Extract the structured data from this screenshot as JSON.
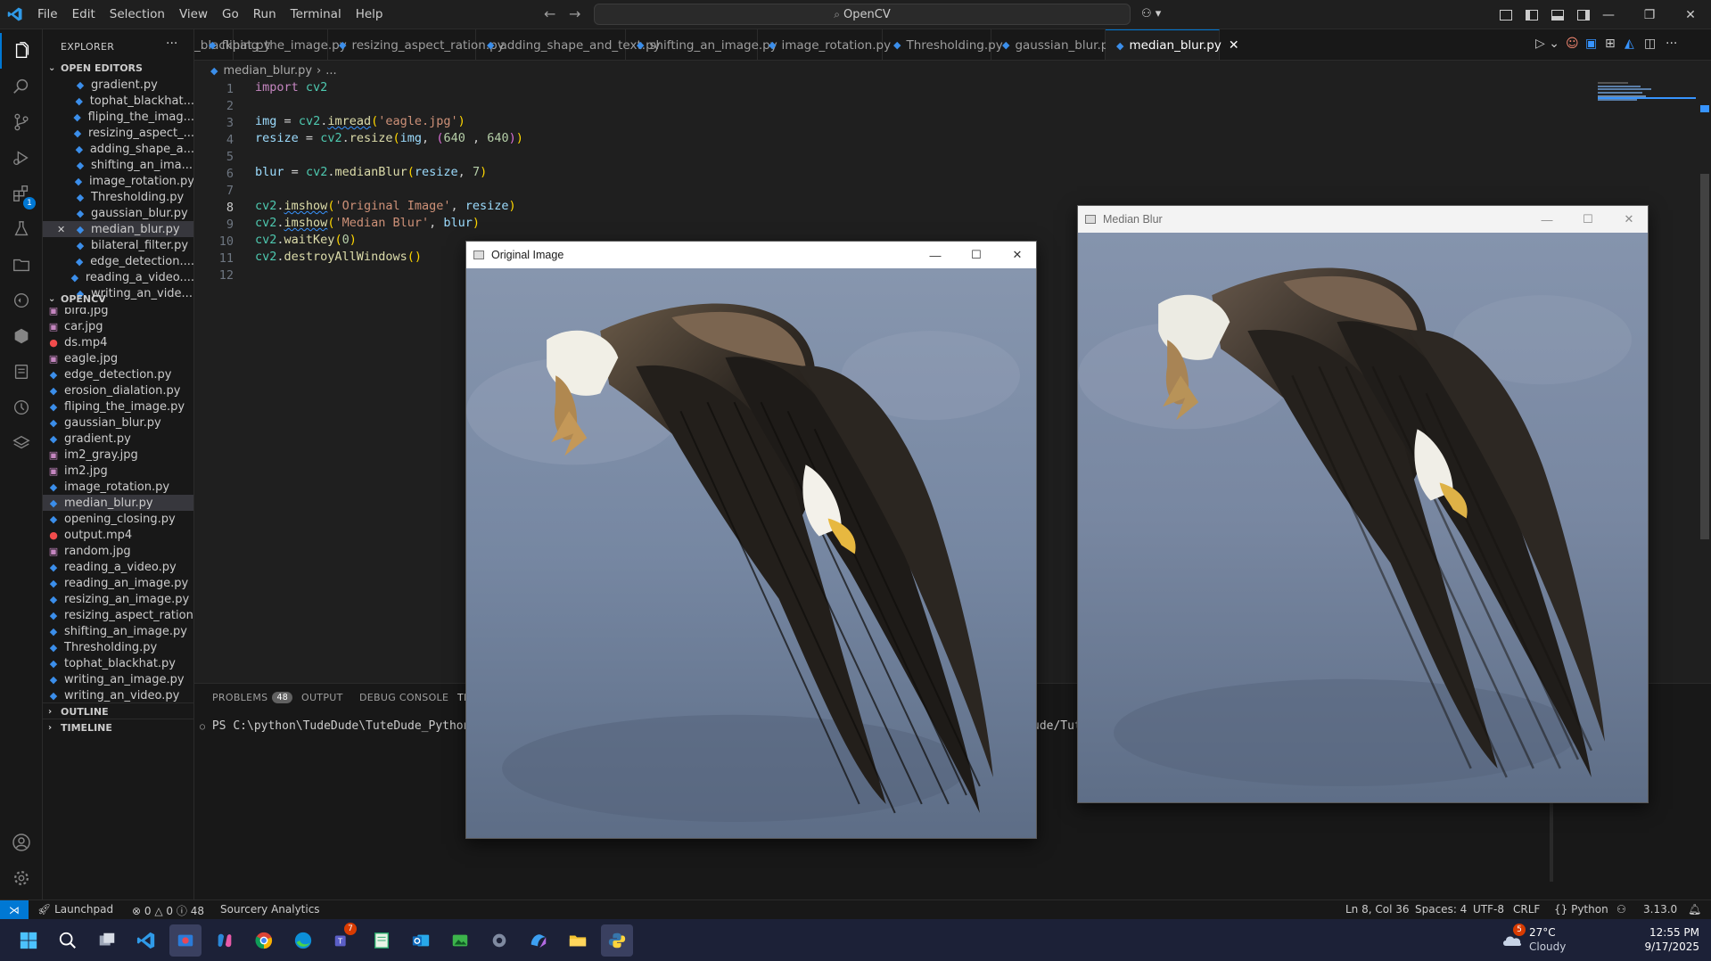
{
  "titlebar": {
    "menus": [
      "File",
      "Edit",
      "Selection",
      "View",
      "Go",
      "Run",
      "Terminal",
      "Help"
    ],
    "search": "OpenCV"
  },
  "sidebar": {
    "title": "EXPLORER",
    "open_editors_label": "OPEN EDITORS",
    "open_editors": [
      "gradient.py",
      "tophat_blackhat...",
      "fliping_the_imag...",
      "resizing_aspect_...",
      "adding_shape_a...",
      "shifting_an_ima...",
      "image_rotation.py",
      "Thresholding.py",
      "gaussian_blur.py",
      "median_blur.py",
      "bilateral_filter.py",
      "edge_detection....",
      "reading_a_video....",
      "writing_an_vide..."
    ],
    "folder_label": "OPENCV",
    "files": [
      {
        "name": "bird.jpg",
        "type": "img"
      },
      {
        "name": "car.jpg",
        "type": "img"
      },
      {
        "name": "ds.mp4",
        "type": "mp4"
      },
      {
        "name": "eagle.jpg",
        "type": "img"
      },
      {
        "name": "edge_detection.py",
        "type": "py"
      },
      {
        "name": "erosion_dialation.py",
        "type": "py"
      },
      {
        "name": "fliping_the_image.py",
        "type": "py"
      },
      {
        "name": "gaussian_blur.py",
        "type": "py"
      },
      {
        "name": "gradient.py",
        "type": "py"
      },
      {
        "name": "im2_gray.jpg",
        "type": "img"
      },
      {
        "name": "im2.jpg",
        "type": "img"
      },
      {
        "name": "image_rotation.py",
        "type": "py"
      },
      {
        "name": "median_blur.py",
        "type": "py"
      },
      {
        "name": "opening_closing.py",
        "type": "py"
      },
      {
        "name": "output.mp4",
        "type": "mp4"
      },
      {
        "name": "random.jpg",
        "type": "img"
      },
      {
        "name": "reading_a_video.py",
        "type": "py"
      },
      {
        "name": "reading_an_image.py",
        "type": "py"
      },
      {
        "name": "resizing_an_image.py",
        "type": "py"
      },
      {
        "name": "resizing_aspect_ration...",
        "type": "py"
      },
      {
        "name": "shifting_an_image.py",
        "type": "py"
      },
      {
        "name": "Thresholding.py",
        "type": "py"
      },
      {
        "name": "tophat_blackhat.py",
        "type": "py"
      },
      {
        "name": "writing_an_image.py",
        "type": "py"
      },
      {
        "name": "writing_an_video.py",
        "type": "py"
      }
    ],
    "outline_label": "OUTLINE",
    "timeline_label": "TIMELINE"
  },
  "tabs": [
    "_blackhat.py",
    "fliping_the_image.py",
    "resizing_aspect_ration.py",
    "adding_shape_and_text.py",
    "shifting_an_image.py",
    "image_rotation.py",
    "Thresholding.py",
    "gaussian_blur.py",
    "median_blur.py"
  ],
  "breadcrumb": {
    "file": "median_blur.py",
    "rest": "..."
  },
  "editor": {
    "line_numbers": [
      "1",
      "2",
      "3",
      "4",
      "5",
      "6",
      "7",
      "8",
      "9",
      "10",
      "11",
      "12"
    ],
    "current_line": 8
  },
  "panel": {
    "tabs": [
      "PROBLEMS",
      "OUTPUT",
      "DEBUG CONSOLE",
      "TE"
    ],
    "problems_count": "48",
    "terminal_line": "PS C:\\python\\TudeDude\\TuteDude_Python\\Ope",
    "terminal_line_right": "ude/Tut"
  },
  "windows": {
    "original": {
      "title": "Original Image"
    },
    "median": {
      "title": "Median Blur"
    }
  },
  "statusbar": {
    "launchpad": "Launchpad",
    "errors": "0",
    "warnings": "0",
    "infos": "48",
    "sourcery": "Sourcery Analytics",
    "position": "Ln 8, Col 36",
    "spaces": "Spaces: 4",
    "encoding": "UTF-8",
    "eol": "CRLF",
    "language": "Python",
    "version": "3.13.0"
  },
  "taskbar": {
    "weather_temp": "27°C",
    "weather_desc": "Cloudy",
    "weather_badge": "5",
    "teams_badge": "7",
    "time": "12:55 PM",
    "date": "9/17/2025"
  },
  "colors": {
    "accent": "#0078d4",
    "editor_bg": "#1f1f1f",
    "sidebar_bg": "#181818"
  }
}
